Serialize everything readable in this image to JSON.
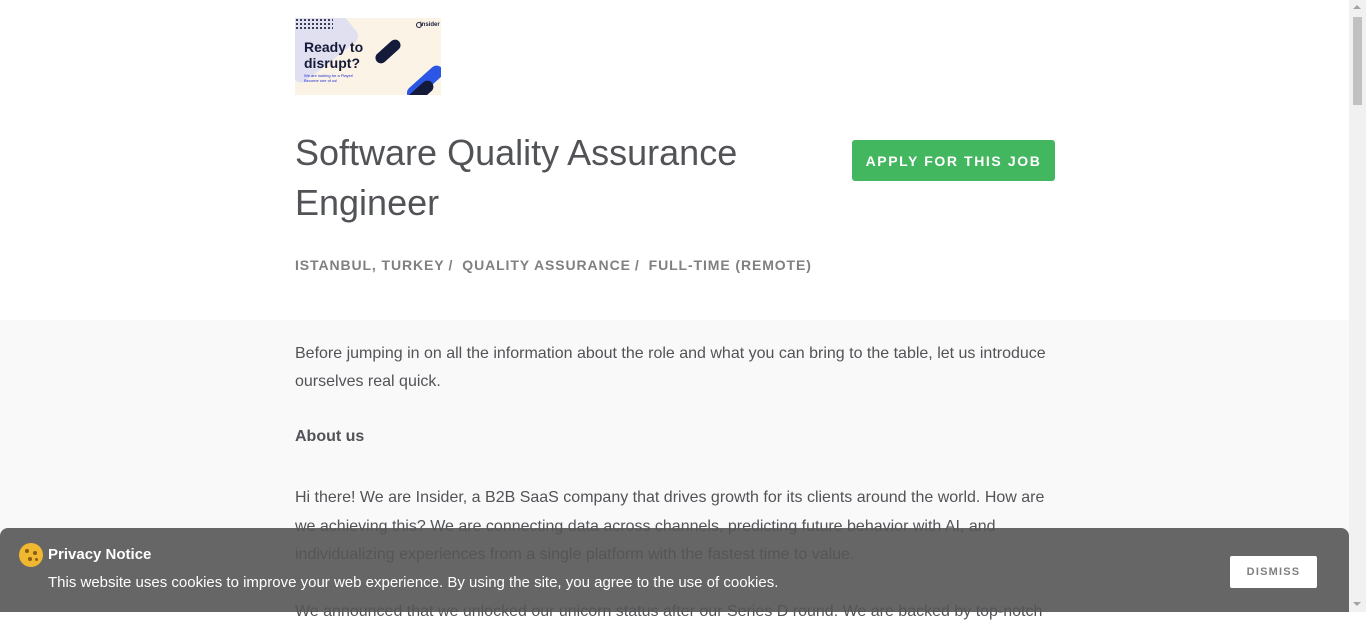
{
  "logo": {
    "tagline_line1": "Ready to",
    "tagline_line2": "disrupt?",
    "small_line1": "We are looking for a Player!",
    "small_line2": "Become one of us!",
    "brand": "insider"
  },
  "posting": {
    "title": "Software Quality Assurance Engineer",
    "apply_label": "APPLY FOR THIS JOB",
    "categories": [
      "ISTANBUL, TURKEY",
      "QUALITY ASSURANCE",
      "FULL-TIME (REMOTE)"
    ],
    "separator": "/"
  },
  "content": {
    "intro": "Before jumping in on all the information about the role and what you can bring to the table, let us introduce ourselves real quick.",
    "about_heading": "About us",
    "about_text": "Hi there! We are Insider, a B2B SaaS company that drives growth for its clients around the world. How are we achieving this? We are connecting data across channels, predicting future behavior with AI, and individualizing experiences from a single platform with the fastest time to value.",
    "more_text": "We announced that we unlocked our unicorn status after our Series D round. We are backed by top-notch"
  },
  "cookie_banner": {
    "title": "Privacy Notice",
    "text": "This website uses cookies to improve your web experience. By using the site, you agree to the use of cookies.",
    "dismiss_label": "DISMISS"
  },
  "colors": {
    "apply_button": "#43b75f",
    "banner_bg": "#555555",
    "text": "#515357"
  },
  "icons": {
    "cookie": "cookie-icon"
  }
}
